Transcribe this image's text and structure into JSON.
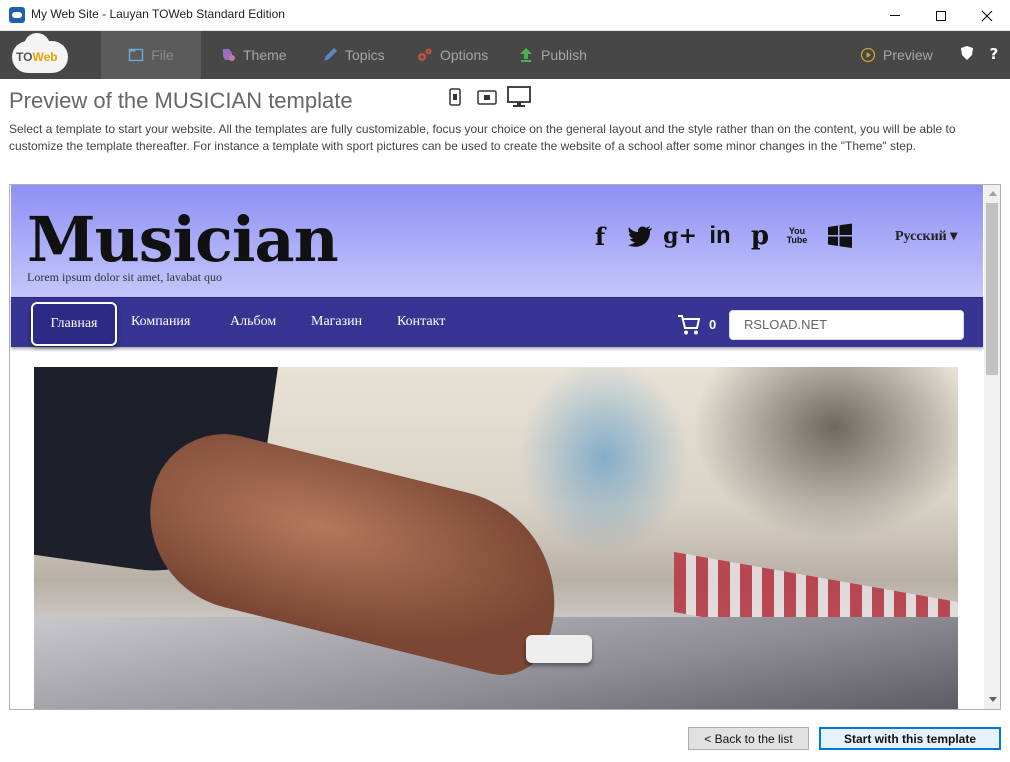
{
  "window": {
    "title": "My Web Site - Lauyan TOWeb Standard Edition"
  },
  "toolbar": {
    "logo_prefix": "TO",
    "logo_suffix": "Web",
    "tabs": [
      {
        "label": "File",
        "icon": "file-icon"
      },
      {
        "label": "Theme",
        "icon": "palette-icon"
      },
      {
        "label": "Topics",
        "icon": "pen-icon"
      },
      {
        "label": "Options",
        "icon": "gears-icon"
      },
      {
        "label": "Publish",
        "icon": "upload-arrow-icon"
      }
    ],
    "preview_label": "Preview",
    "help_label": "?"
  },
  "header": {
    "title": "Preview of the MUSICIAN template",
    "description": "Select a template to start your website. All the templates are fully customizable, focus your choice on the general layout and the style rather than on the content, you will be able to customize the template thereafter. For instance a template with sport pictures can be used to create the website of a school after some minor changes in the \"Theme\" step."
  },
  "site_preview": {
    "site_name": "Musician",
    "tagline": "Lorem ipsum dolor sit amet, lavabat quo",
    "social": [
      {
        "icon": "facebook-icon",
        "glyph": "f"
      },
      {
        "icon": "twitter-icon",
        "glyph": "t"
      },
      {
        "icon": "google-plus-icon",
        "glyph": "g+"
      },
      {
        "icon": "linkedin-icon",
        "glyph": "in"
      },
      {
        "icon": "pinterest-icon",
        "glyph": "p"
      },
      {
        "icon": "youtube-icon",
        "glyph": "You Tube"
      },
      {
        "icon": "windows-icon",
        "glyph": ""
      }
    ],
    "language": "Русский ▾",
    "nav": [
      "Главная",
      "Компания",
      "Альбом",
      "Магазин",
      "Контакт"
    ],
    "cart_count": "0",
    "search_value": "RSLOAD.NET"
  },
  "footer": {
    "back_label": "< Back to the list",
    "start_label": "Start with this template"
  },
  "colors": {
    "toolbar": "#474747",
    "site_nav": "#383493",
    "header_top": "#8e90f4",
    "accent_button": "#0078d7"
  }
}
